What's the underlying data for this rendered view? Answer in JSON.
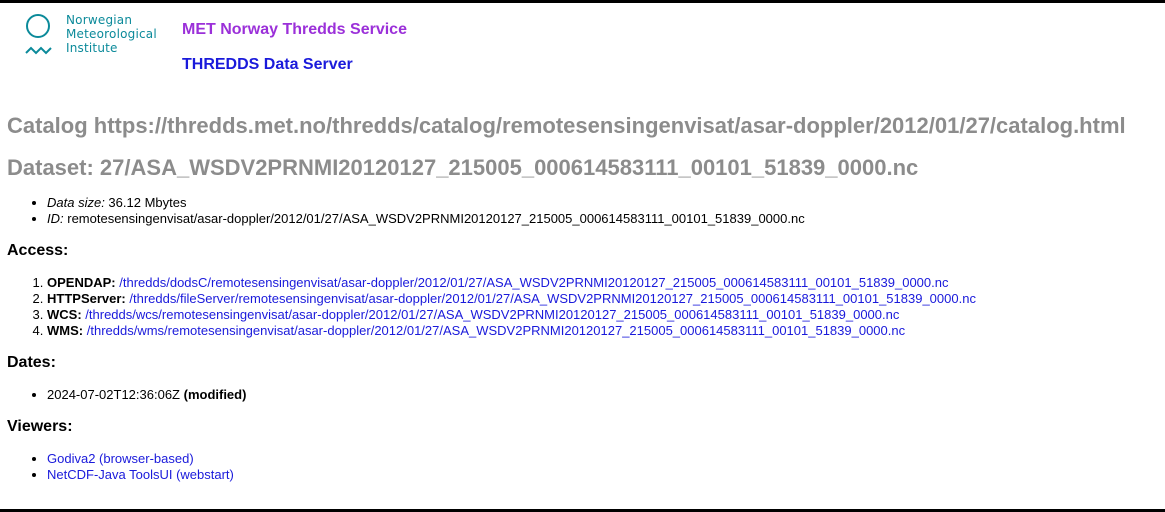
{
  "header": {
    "logo_lines": [
      "Norwegian",
      "Meteorological",
      "Institute"
    ],
    "service_title": "MET Norway Thredds Service",
    "server_title": "THREDDS Data Server"
  },
  "catalog": {
    "title": "Catalog https://thredds.met.no/thredds/catalog/remotesensingenvisat/asar-doppler/2012/01/27/catalog.html"
  },
  "dataset": {
    "title": "Dataset: 27/ASA_WSDV2PRNMI20120127_215005_000614583111_00101_51839_0000.nc",
    "info": [
      {
        "label": "Data size:",
        "value": " 36.12 Mbytes"
      },
      {
        "label": "ID:",
        "value": " remotesensingenvisat/asar-doppler/2012/01/27/ASA_WSDV2PRNMI20120127_215005_000614583111_00101_51839_0000.nc"
      }
    ]
  },
  "access": {
    "heading": "Access:",
    "items": [
      {
        "service": "OPENDAP:",
        "url": "/thredds/dodsC/remotesensingenvisat/asar-doppler/2012/01/27/ASA_WSDV2PRNMI20120127_215005_000614583111_00101_51839_0000.nc"
      },
      {
        "service": "HTTPServer:",
        "url": "/thredds/fileServer/remotesensingenvisat/asar-doppler/2012/01/27/ASA_WSDV2PRNMI20120127_215005_000614583111_00101_51839_0000.nc"
      },
      {
        "service": "WCS:",
        "url": "/thredds/wcs/remotesensingenvisat/asar-doppler/2012/01/27/ASA_WSDV2PRNMI20120127_215005_000614583111_00101_51839_0000.nc"
      },
      {
        "service": "WMS:",
        "url": "/thredds/wms/remotesensingenvisat/asar-doppler/2012/01/27/ASA_WSDV2PRNMI20120127_215005_000614583111_00101_51839_0000.nc"
      }
    ]
  },
  "dates": {
    "heading": "Dates:",
    "items": [
      {
        "value": "2024-07-02T12:36:06Z ",
        "type": "(modified)"
      }
    ]
  },
  "viewers": {
    "heading": "Viewers:",
    "items": [
      {
        "label": "Godiva2 (browser-based)"
      },
      {
        "label": "NetCDF-Java ToolsUI (webstart)"
      }
    ]
  },
  "colors": {
    "logo": "#0b8a9a",
    "service_title": "#9b30d9",
    "link": "#1a1adb",
    "heading_gray": "#8c8c8c"
  }
}
